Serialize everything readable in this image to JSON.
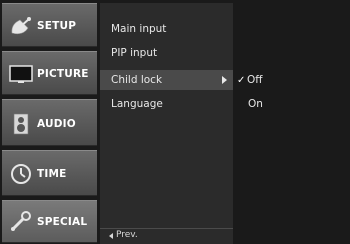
{
  "categories": [
    {
      "label": "SETUP",
      "icon": "satellite-dish-icon"
    },
    {
      "label": "PICTURE",
      "icon": "monitor-icon"
    },
    {
      "label": "AUDIO",
      "icon": "speaker-icon"
    },
    {
      "label": "TIME",
      "icon": "clock-icon"
    },
    {
      "label": "SPECIAL",
      "icon": "wrench-icon"
    }
  ],
  "active_category": "SPECIAL",
  "submenu": {
    "items": [
      "Main input",
      "PIP input",
      "Child lock",
      "Language"
    ],
    "selected": "Child lock",
    "prev_label": "Prev."
  },
  "options": {
    "items": [
      "Off",
      "On"
    ],
    "selected": "Off",
    "check_mark": "✓"
  },
  "colors": {
    "background": "#1a1a1a",
    "category_bg": "#5a5a5a",
    "submenu_bg": "#2b2b2b",
    "highlight": "#4a4a4a",
    "text": "#e8e8e8"
  }
}
